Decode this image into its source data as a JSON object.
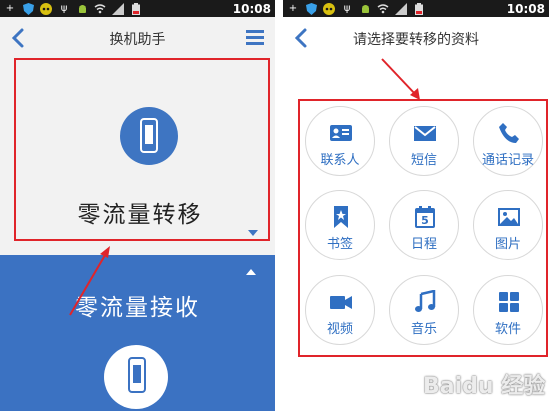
{
  "colors": {
    "brand_blue": "#3e75c2",
    "annotation_red": "#e0242a",
    "status_bar": "#1a1a1a"
  },
  "left": {
    "status_time": "10:08",
    "title": "换机助手",
    "send_option": {
      "label": "零流量转移",
      "icon": "phone-icon"
    },
    "receive_option": {
      "label": "零流量接收",
      "icon": "phone-icon"
    }
  },
  "right": {
    "status_time": "10:08",
    "title": "请选择要转移的资料",
    "items": [
      {
        "label": "联系人",
        "icon": "contact-card-icon"
      },
      {
        "label": "短信",
        "icon": "envelope-icon"
      },
      {
        "label": "通话记录",
        "icon": "phone-handset-icon"
      },
      {
        "label": "书签",
        "icon": "bookmark-icon"
      },
      {
        "label": "日程",
        "icon": "calendar-icon",
        "day": "5"
      },
      {
        "label": "图片",
        "icon": "picture-icon"
      },
      {
        "label": "视频",
        "icon": "video-camera-icon"
      },
      {
        "label": "音乐",
        "icon": "music-note-icon"
      },
      {
        "label": "软件",
        "icon": "apps-grid-icon"
      }
    ]
  },
  "watermark": "Baidu 经验"
}
